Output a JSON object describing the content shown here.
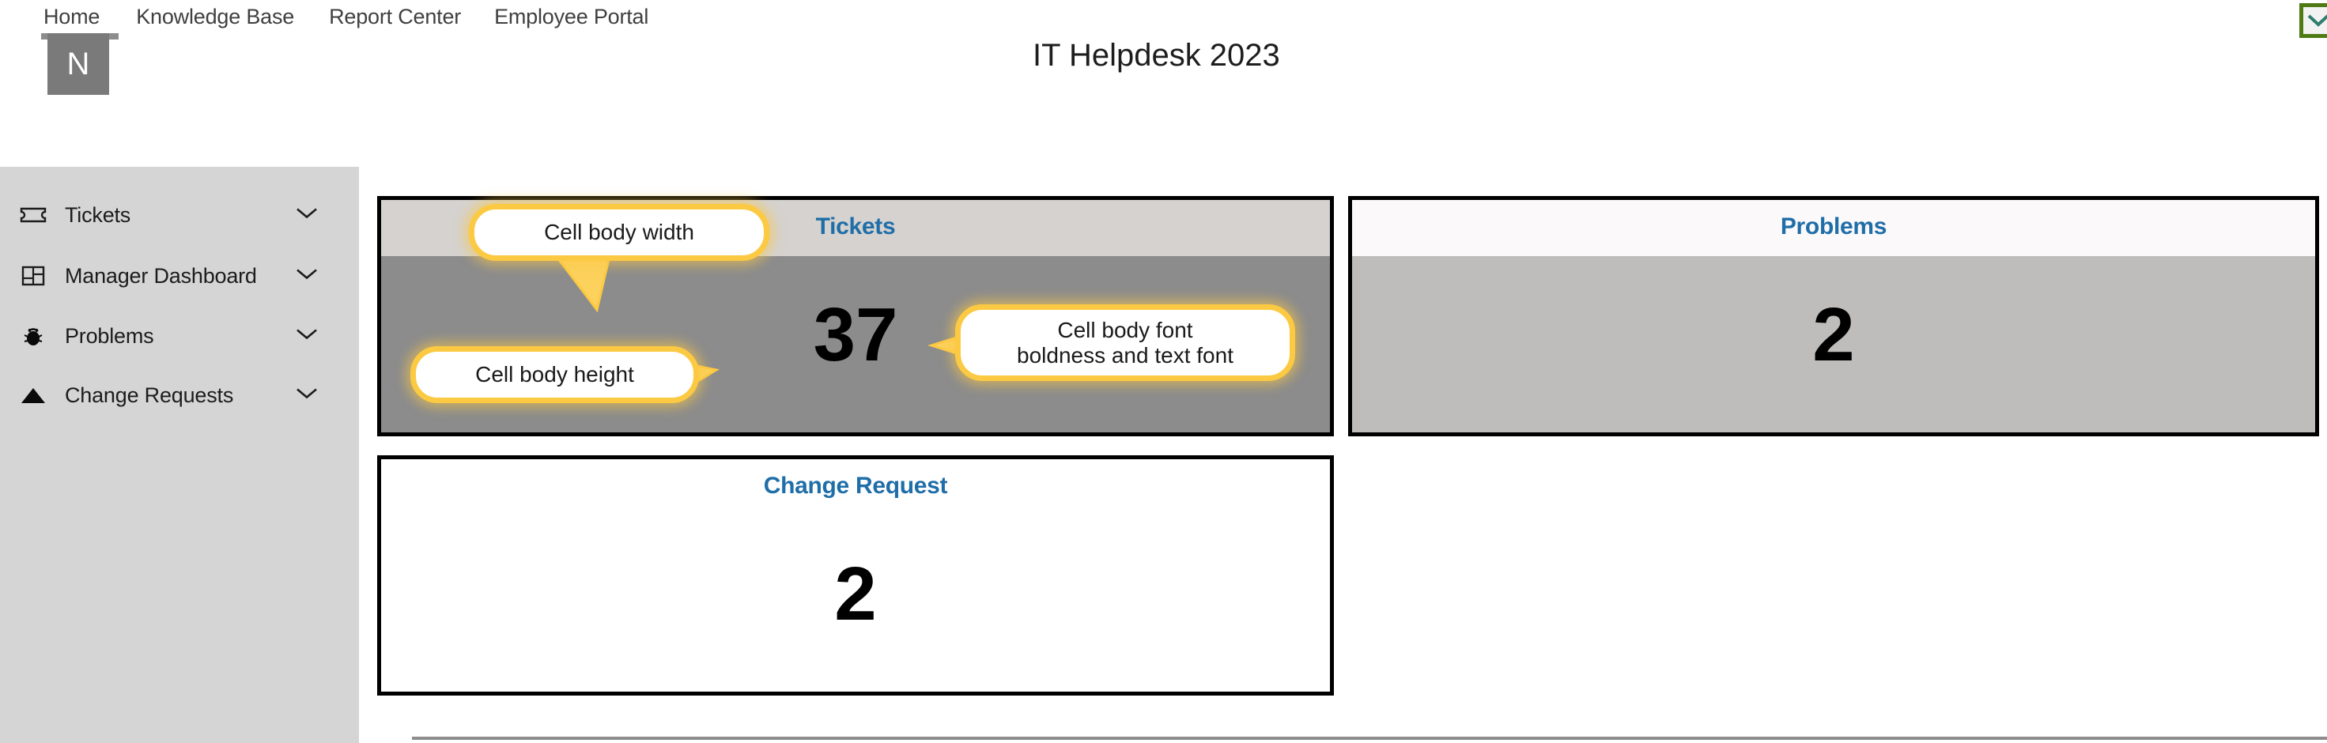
{
  "header": {
    "title": "IT Helpdesk 2023",
    "avatar_letter": "N",
    "nav": [
      {
        "label": "Home",
        "active": true
      },
      {
        "label": "Knowledge Base",
        "active": false
      },
      {
        "label": "Report Center",
        "active": false
      },
      {
        "label": "Employee Portal",
        "active": false
      }
    ],
    "top_right_control": {
      "icon": "chevron-down-icon",
      "border_color": "#4f7b14"
    }
  },
  "sidebar": {
    "background": "#d5d5d5",
    "items": [
      {
        "label": "Tickets",
        "icon": "ticket-icon",
        "expander": "chevron-down-icon"
      },
      {
        "label": "Manager Dashboard",
        "icon": "dashboard-grid-icon",
        "expander": "chevron-down-icon"
      },
      {
        "label": "Problems",
        "icon": "bug-icon",
        "expander": "chevron-down-icon"
      },
      {
        "label": "Change Requests",
        "icon": "triangle-icon",
        "expander": "chevron-down-icon"
      }
    ]
  },
  "cards": [
    {
      "key": "tickets",
      "title": "Tickets",
      "value": "37",
      "title_color": "#1f6ea8",
      "header_bg": "#d5d2cf",
      "body_bg": "#8c8c8c"
    },
    {
      "key": "problems",
      "title": "Problems",
      "value": "2",
      "title_color": "#1f6ea8",
      "header_bg": "#fbf9fa",
      "body_bg": "#bfbdbb"
    },
    {
      "key": "change",
      "title": "Change Request",
      "value": "2",
      "title_color": "#1f6ea8",
      "header_bg": "#ffffff",
      "body_bg": "#ffffff"
    }
  ],
  "annotations": {
    "accent_color": "#fcc943",
    "callouts": [
      {
        "key": "width",
        "text": "Cell body width"
      },
      {
        "key": "height",
        "text": "Cell body height"
      },
      {
        "key": "font",
        "line1": "Cell body font",
        "line2": "boldness and text font"
      }
    ]
  }
}
